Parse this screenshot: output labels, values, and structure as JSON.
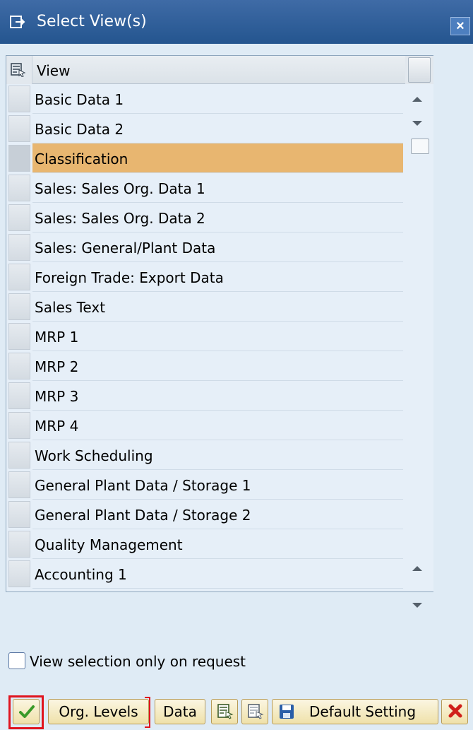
{
  "window": {
    "title": "Select View(s)",
    "close_label": "×"
  },
  "table": {
    "column_header": "View",
    "rows": [
      {
        "label": "Basic Data 1",
        "selected": false
      },
      {
        "label": "Basic Data 2",
        "selected": false
      },
      {
        "label": "Classification",
        "selected": true
      },
      {
        "label": "Sales: Sales Org. Data 1",
        "selected": false
      },
      {
        "label": "Sales: Sales Org. Data 2",
        "selected": false
      },
      {
        "label": "Sales: General/Plant Data",
        "selected": false
      },
      {
        "label": "Foreign Trade: Export Data",
        "selected": false
      },
      {
        "label": "Sales Text",
        "selected": false
      },
      {
        "label": "MRP 1",
        "selected": false
      },
      {
        "label": "MRP 2",
        "selected": false
      },
      {
        "label": "MRP 3",
        "selected": false
      },
      {
        "label": "MRP 4",
        "selected": false
      },
      {
        "label": "Work Scheduling",
        "selected": false
      },
      {
        "label": "General Plant Data / Storage 1",
        "selected": false
      },
      {
        "label": "General Plant Data / Storage 2",
        "selected": false
      },
      {
        "label": "Quality Management",
        "selected": false
      },
      {
        "label": "Accounting 1",
        "selected": false
      }
    ]
  },
  "options": {
    "view_selection_label": "View selection only on request",
    "view_selection_checked": false
  },
  "toolbar": {
    "org_levels_label": "Org. Levels",
    "data_label": "Data",
    "default_setting_label": "Default Setting"
  },
  "colors": {
    "title_bar": "#2f5f9a",
    "selected_row": "#e8b670",
    "highlight": "#e0141e",
    "confirm_green": "#3a9a2a",
    "cancel_red": "#d0201a"
  }
}
